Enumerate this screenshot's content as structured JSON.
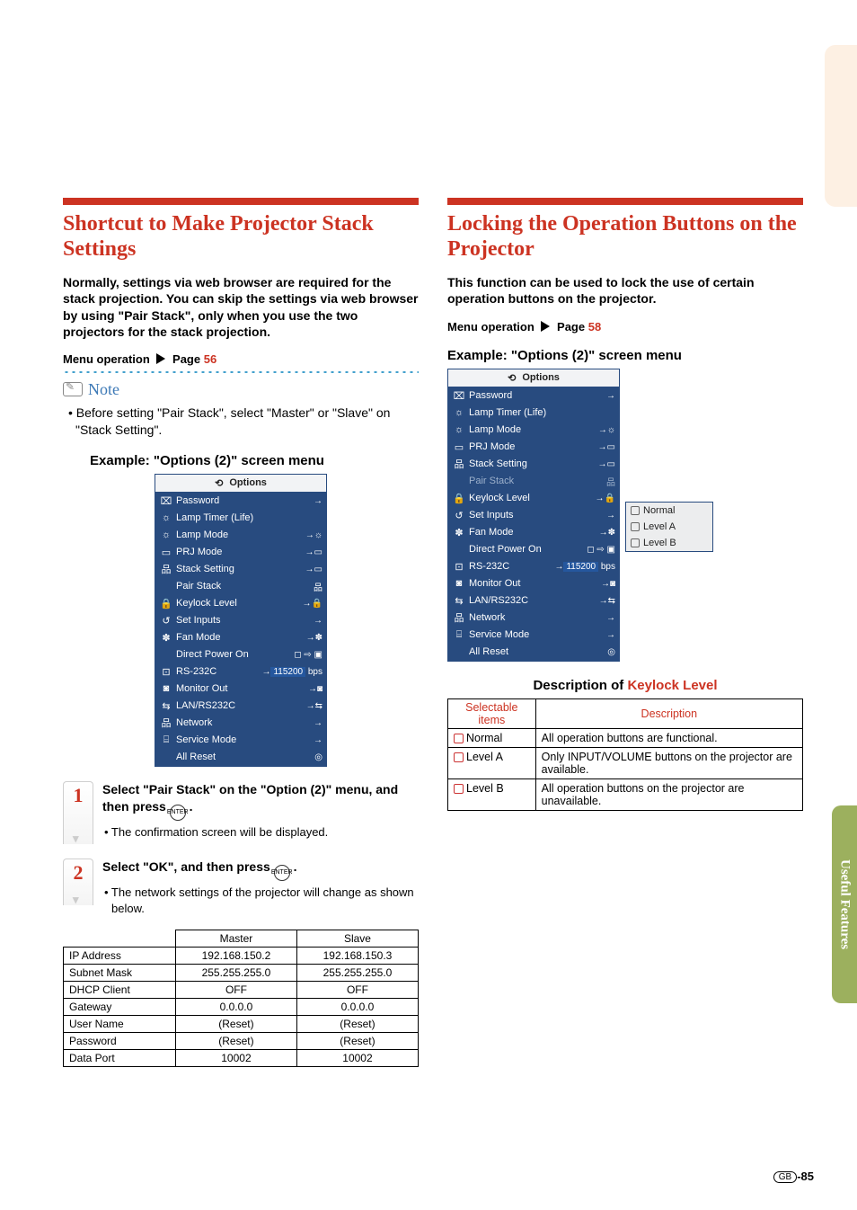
{
  "left": {
    "title": "Shortcut to Make Projector Stack Settings",
    "intro": "Normally, settings via web browser are required for the stack projection. You can skip the settings via web browser by using \"Pair Stack\", only when you use the two projectors for the stack projection.",
    "menu_op_label": "Menu operation",
    "menu_op_page_prefix": "Page ",
    "menu_op_page": "56",
    "note_label": "Note",
    "note_body": "• Before setting \"Pair Stack\", select \"Master\" or \"Slave\" on \"Stack Setting\".",
    "example_heading": "Example: \"Options (2)\" screen menu",
    "step1_num": "1",
    "step1_title": "Select \"Pair Stack\" on the \"Option (2)\" menu, and then press ",
    "step1_sub": "• The confirmation screen will be displayed.",
    "step2_num": "2",
    "step2_title": "Select \"OK\", and then press ",
    "step2_sub": "• The network settings of the projector will change as shown below.",
    "net_table": {
      "headers": [
        "",
        "Master",
        "Slave"
      ],
      "rows": [
        [
          "IP Address",
          "192.168.150.2",
          "192.168.150.3"
        ],
        [
          "Subnet Mask",
          "255.255.255.0",
          "255.255.255.0"
        ],
        [
          "DHCP Client",
          "OFF",
          "OFF"
        ],
        [
          "Gateway",
          "0.0.0.0",
          "0.0.0.0"
        ],
        [
          "User Name",
          "(Reset)",
          "(Reset)"
        ],
        [
          "Password",
          "(Reset)",
          "(Reset)"
        ],
        [
          "Data Port",
          "10002",
          "10002"
        ]
      ]
    }
  },
  "right": {
    "title": "Locking the Operation Buttons on the Projector",
    "intro": "This function can be used to lock the use of certain operation buttons on the projector.",
    "menu_op_label": "Menu operation",
    "menu_op_page_prefix": "Page ",
    "menu_op_page": "58",
    "example_heading": "Example: \"Options (2)\" screen menu",
    "submenu": [
      "Normal",
      "Level A",
      "Level B"
    ],
    "desc_title_prefix": "Description of ",
    "desc_title_link": "Keylock Level",
    "desc_headers": [
      "Selectable items",
      "Description"
    ],
    "desc_rows": [
      [
        "Normal",
        "All operation buttons are functional."
      ],
      [
        "Level A",
        "Only INPUT/VOLUME buttons on the projector are available."
      ],
      [
        "Level B",
        "All operation buttons on the projector are unavailable."
      ]
    ]
  },
  "menu": {
    "title": "Options",
    "items": [
      {
        "icon": "⌧",
        "label": "Password",
        "tail": "→"
      },
      {
        "icon": "☼",
        "label": "Lamp Timer (Life)",
        "tail": ""
      },
      {
        "icon": "☼",
        "label": "Lamp Mode",
        "tail": "→☼"
      },
      {
        "icon": "▭",
        "label": "PRJ Mode",
        "tail": "→▭"
      },
      {
        "icon": "品",
        "label": "Stack Setting",
        "tail": "→▭"
      },
      {
        "icon": "",
        "label": "Pair Stack",
        "tail": "品"
      },
      {
        "icon": "🔒",
        "label": "Keylock Level",
        "tail": "→🔒"
      },
      {
        "icon": "↺",
        "label": "Set Inputs",
        "tail": "→"
      },
      {
        "icon": "✽",
        "label": "Fan Mode",
        "tail": "→✽"
      },
      {
        "icon": "",
        "label": "Direct Power On",
        "tail": "◻ ⇨ ▣"
      },
      {
        "icon": "⊡",
        "label": "RS-232C",
        "tail_left": "→",
        "tail_hl": "115200",
        "tail_right": " bps"
      },
      {
        "icon": "◙",
        "label": "Monitor Out",
        "tail": "→◙"
      },
      {
        "icon": "⇆",
        "label": "LAN/RS232C",
        "tail": "→⇆"
      },
      {
        "icon": "品",
        "label": "Network",
        "tail": "→"
      },
      {
        "icon": "⌸",
        "label": "Service Mode",
        "tail": "→"
      },
      {
        "icon": "",
        "label": "All Reset",
        "tail": "◎"
      }
    ]
  },
  "side_tab": "Useful Features",
  "page_number": "-85",
  "page_gb": "GB"
}
